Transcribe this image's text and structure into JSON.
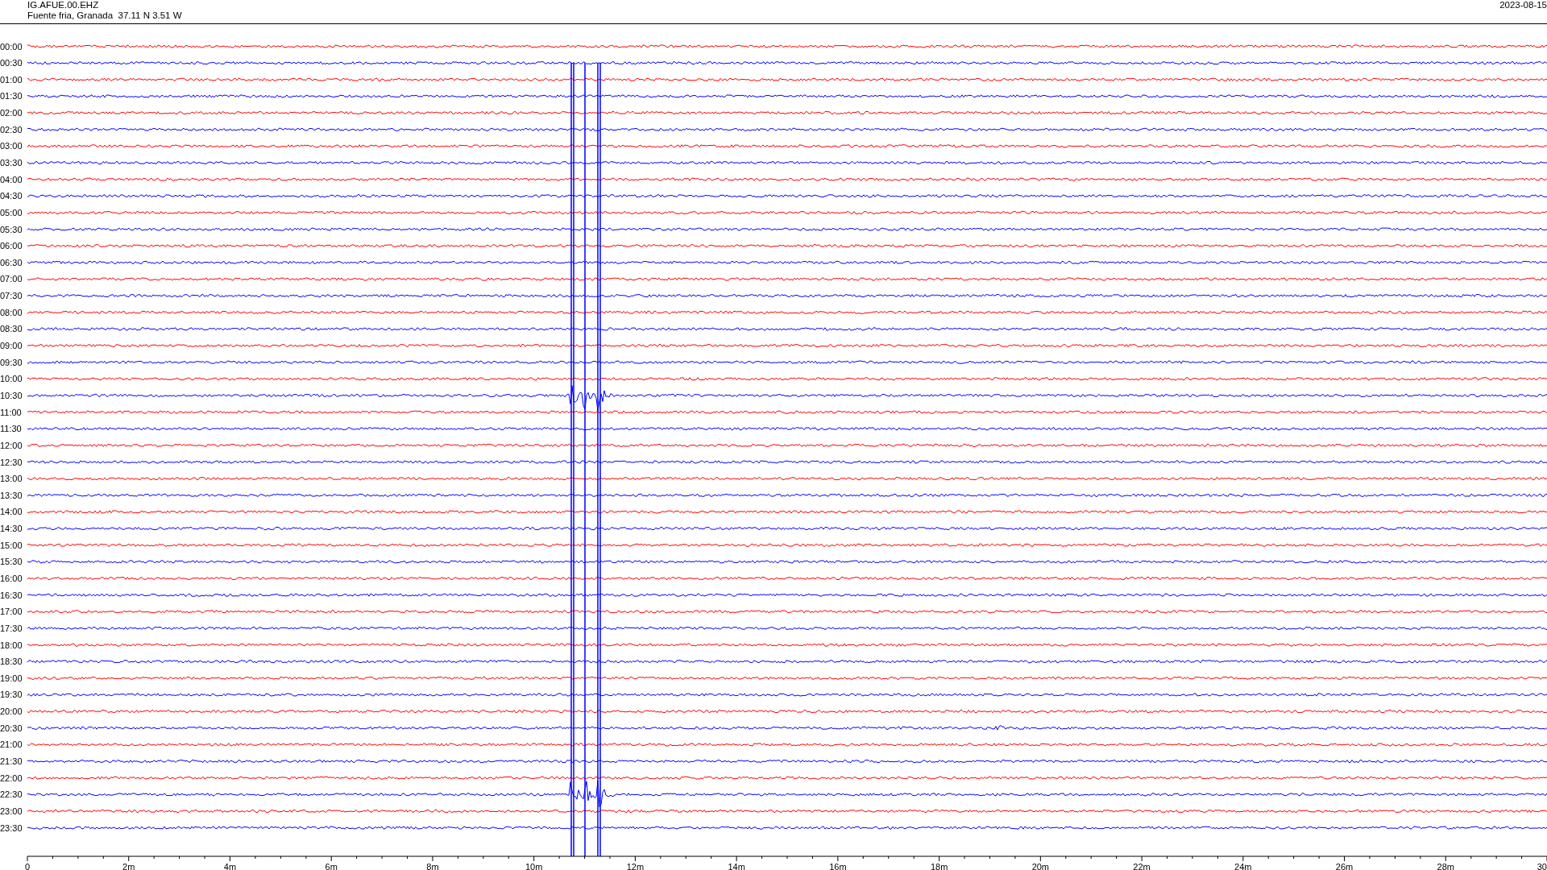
{
  "header": {
    "station": "IG.AFUE.00.EHZ",
    "location": "Fuente fria, Granada  37.11 N 3.51 W",
    "date": "2023-08-15"
  },
  "rows": [
    {
      "label": "00:00",
      "color": "#ff0000"
    },
    {
      "label": "00:30",
      "color": "#0000ff"
    },
    {
      "label": "01:00",
      "color": "#ff0000"
    },
    {
      "label": "01:30",
      "color": "#0000ff"
    },
    {
      "label": "02:00",
      "color": "#ff0000"
    },
    {
      "label": "02:30",
      "color": "#0000ff"
    },
    {
      "label": "03:00",
      "color": "#ff0000"
    },
    {
      "label": "03:30",
      "color": "#0000ff"
    },
    {
      "label": "04:00",
      "color": "#ff0000"
    },
    {
      "label": "04:30",
      "color": "#0000ff"
    },
    {
      "label": "05:00",
      "color": "#ff0000"
    },
    {
      "label": "05:30",
      "color": "#0000ff"
    },
    {
      "label": "06:00",
      "color": "#ff0000"
    },
    {
      "label": "06:30",
      "color": "#0000ff"
    },
    {
      "label": "07:00",
      "color": "#ff0000"
    },
    {
      "label": "07:30",
      "color": "#0000ff"
    },
    {
      "label": "08:00",
      "color": "#ff0000"
    },
    {
      "label": "08:30",
      "color": "#0000ff"
    },
    {
      "label": "09:00",
      "color": "#ff0000"
    },
    {
      "label": "09:30",
      "color": "#0000ff"
    },
    {
      "label": "10:00",
      "color": "#ff0000"
    },
    {
      "label": "10:30",
      "color": "#0000ff"
    },
    {
      "label": "11:00",
      "color": "#ff0000"
    },
    {
      "label": "11:30",
      "color": "#0000ff"
    },
    {
      "label": "12:00",
      "color": "#ff0000"
    },
    {
      "label": "12:30",
      "color": "#0000ff"
    },
    {
      "label": "13:00",
      "color": "#ff0000"
    },
    {
      "label": "13:30",
      "color": "#0000ff"
    },
    {
      "label": "14:00",
      "color": "#ff0000"
    },
    {
      "label": "14:30",
      "color": "#0000ff"
    },
    {
      "label": "15:00",
      "color": "#ff0000"
    },
    {
      "label": "15:30",
      "color": "#0000ff"
    },
    {
      "label": "16:00",
      "color": "#ff0000"
    },
    {
      "label": "16:30",
      "color": "#0000ff"
    },
    {
      "label": "17:00",
      "color": "#ff0000"
    },
    {
      "label": "17:30",
      "color": "#0000ff"
    },
    {
      "label": "18:00",
      "color": "#ff0000"
    },
    {
      "label": "18:30",
      "color": "#0000ff"
    },
    {
      "label": "19:00",
      "color": "#ff0000"
    },
    {
      "label": "19:30",
      "color": "#0000ff"
    },
    {
      "label": "20:00",
      "color": "#ff0000"
    },
    {
      "label": "20:30",
      "color": "#0000ff"
    },
    {
      "label": "21:00",
      "color": "#ff0000"
    },
    {
      "label": "21:30",
      "color": "#0000ff"
    },
    {
      "label": "22:00",
      "color": "#ff0000"
    },
    {
      "label": "22:30",
      "color": "#0000ff"
    },
    {
      "label": "23:00",
      "color": "#ff0000"
    },
    {
      "label": "23:30",
      "color": "#0000ff"
    }
  ],
  "x_axis": {
    "labels": [
      "0",
      "2m",
      "4m",
      "6m",
      "8m",
      "10m",
      "12m",
      "14m",
      "16m",
      "18m",
      "20m",
      "22m",
      "24m",
      "26m",
      "28m",
      "30"
    ]
  }
}
